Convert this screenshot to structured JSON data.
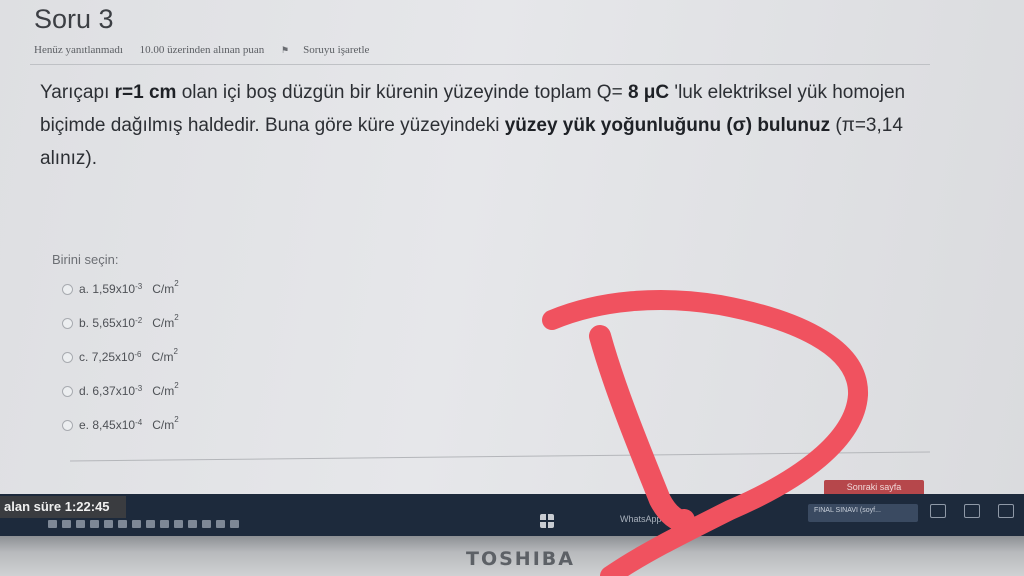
{
  "question": {
    "title": "Soru 3",
    "status": "Henüz yanıtlanmadı",
    "points": "10.00 üzerinden alınan puan",
    "flag_label": "Soruyu işaretle",
    "text_part1": "Yarıçapı ",
    "text_bold1": "r=1 cm",
    "text_part2": " olan içi boş düzgün bir kürenin yüzeyinde toplam Q= ",
    "text_bold2": "8 μC",
    "text_part3": " 'luk elektriksel yük homojen biçimde dağılmış haldedir. Buna göre küre yüzeyindeki ",
    "text_bold3": "yüzey yük yoğunluğunu (σ) bulunuz",
    "text_part4": " (π=3,14 alınız)."
  },
  "answer": {
    "prompt": "Birini seçin:",
    "options": [
      {
        "letter": "a.",
        "mantissa": "1,59x10",
        "exp": "-3",
        "unit": "C/m",
        "unit_exp": "2"
      },
      {
        "letter": "b.",
        "mantissa": "5,65x10",
        "exp": "-2",
        "unit": "C/m",
        "unit_exp": "2"
      },
      {
        "letter": "c.",
        "mantissa": "7,25x10",
        "exp": "-6",
        "unit": "C/m",
        "unit_exp": "2"
      },
      {
        "letter": "d.",
        "mantissa": "6,37x10",
        "exp": "-3",
        "unit": "C/m",
        "unit_exp": "2"
      },
      {
        "letter": "e.",
        "mantissa": "8,45x10",
        "exp": "-4",
        "unit": "C/m",
        "unit_exp": "2"
      }
    ]
  },
  "navigation": {
    "next_label": "Sonraki sayfa"
  },
  "timer": {
    "label": "alan süre",
    "value": "1:22:45"
  },
  "taskbar": {
    "app1": "WhatsApp",
    "app2": "FINAL SINAVI (soyf..."
  },
  "laptop": {
    "brand": "TOSHIBA"
  },
  "colors": {
    "annotation": "#f0525f",
    "next_button": "#b6474b"
  }
}
